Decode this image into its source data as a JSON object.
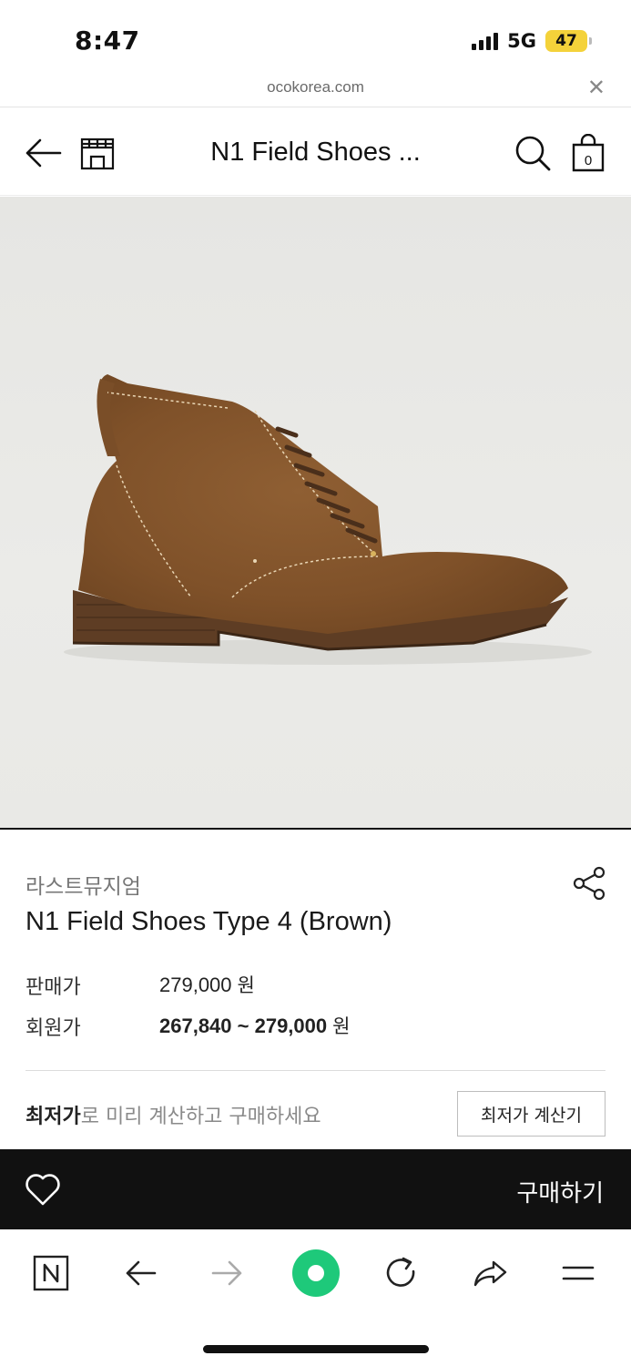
{
  "status_bar": {
    "time": "8:47",
    "network": "5G",
    "battery": "47",
    "battery_color": "#f4d23a"
  },
  "browser_url": {
    "domain": "ocokorea.com",
    "close_icon": "close-icon"
  },
  "header": {
    "title": "N1 Field Shoes ...",
    "cart_count": "0",
    "icons": [
      "back-arrow-icon",
      "store-icon",
      "search-icon",
      "shopping-bag-icon"
    ]
  },
  "product": {
    "image_icon": "brown-suede-boot-image",
    "brand": "라스트뮤지엄",
    "name": "N1 Field Shoes Type 4 (Brown)",
    "sale_price_label": "판매가",
    "sale_price": "279,000",
    "member_price_label": "회원가",
    "member_price": "267,840 ~ 279,000",
    "currency": "원",
    "lowest_price_emphasis": "최저가",
    "lowest_price_text": "로 미리 계산하고 구매하세요",
    "lowest_price_button": "최저가 계산기"
  },
  "buy_bar": {
    "wishlist_icon": "heart-icon",
    "buy_label": "구매하기",
    "background": "#111111"
  },
  "browser_toolbar": {
    "icons": [
      "naver-n-icon",
      "back-icon",
      "forward-icon",
      "green-circle-icon",
      "refresh-icon",
      "share-icon",
      "menu-icon"
    ],
    "accent": "#1ec97a"
  }
}
